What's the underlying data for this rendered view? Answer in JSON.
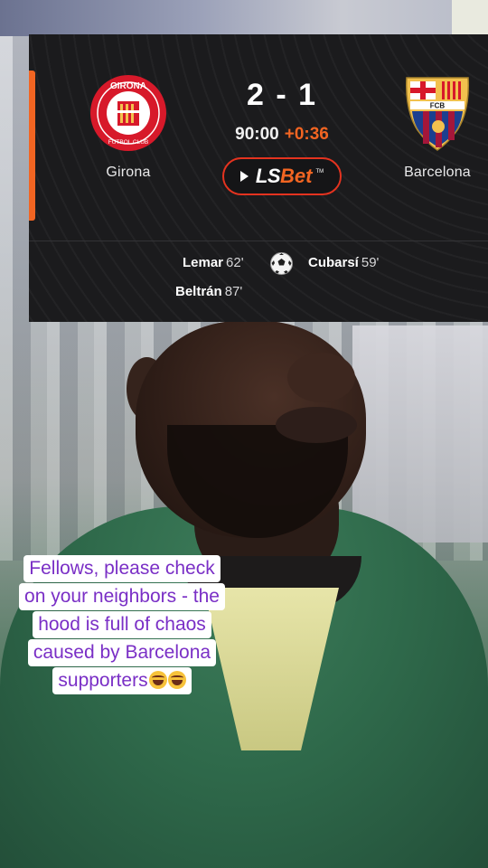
{
  "scoreboard": {
    "home": {
      "name": "Girona",
      "crest_icon": "girona-crest-icon",
      "crest_text": "GIRONA",
      "crest_sub": "FUTBOL CLUB"
    },
    "away": {
      "name": "Barcelona",
      "crest_icon": "barcelona-crest-icon",
      "crest_text": "FCB"
    },
    "score": "2 - 1",
    "clock": "90:00",
    "added_time": "+0:36",
    "sponsor": {
      "name_a": "LS",
      "name_b": "Bet",
      "tm": "TM"
    },
    "scorers": {
      "home": [
        {
          "name": "Lemar",
          "minute": "62'"
        },
        {
          "name": "Beltrán",
          "minute": "87'"
        }
      ],
      "away": [
        {
          "name": "Cubarsí",
          "minute": "59'"
        }
      ]
    },
    "colors": {
      "accent": "#f26522",
      "sponsor_border": "#e4331f",
      "background": "#1b1b1d"
    }
  },
  "caption": {
    "lines": [
      "Fellows, please check",
      "on your neighbors - the",
      "hood is full of chaos",
      "caused by Barcelona",
      "supporters"
    ],
    "emoji": "laughing-tears-emoji",
    "color": "#7a2fc6"
  }
}
